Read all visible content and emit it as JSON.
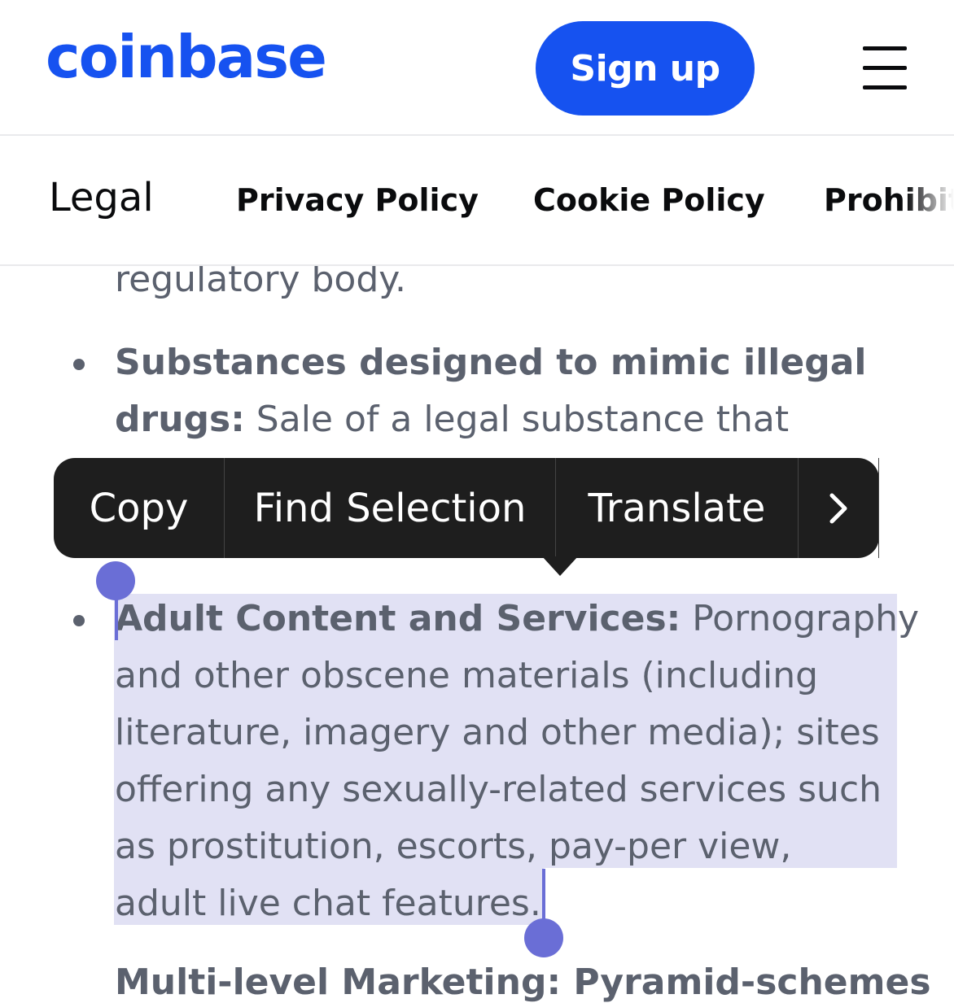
{
  "header": {
    "logo": "coinbase",
    "signup_label": "Sign up",
    "menu_icon": "hamburger-menu-icon"
  },
  "subnav": {
    "section_title": "Legal",
    "links": [
      "Privacy Policy",
      "Cookie Policy",
      "Prohibit"
    ]
  },
  "content": {
    "partial_line": "regulatory body.",
    "item1": {
      "title_line1": "Substances designed to mimic illegal",
      "title_line2": "drugs:",
      "desc_line2": " Sale of a legal substance that"
    },
    "item2": {
      "title": "Adult Content and Services:",
      "desc_line1": " Pornography",
      "lines": [
        "and other obscene materials (including",
        "literature, imagery and other media); sites",
        "offering any sexually-related services such",
        "as prostitution, escorts, pay-per view,",
        "adult live chat features."
      ]
    },
    "next_partial": "Multi-level Marketing: Pyramid-schemes"
  },
  "context_menu": {
    "items": [
      "Copy",
      "Find Selection",
      "Translate"
    ],
    "more_icon": "chevron-right-icon"
  },
  "colors": {
    "brand": "#1652f0",
    "text": "#5b616e",
    "selection": "#dcdcf2",
    "handle": "#6a6ed6",
    "menu_bg": "#1e1e1e"
  }
}
